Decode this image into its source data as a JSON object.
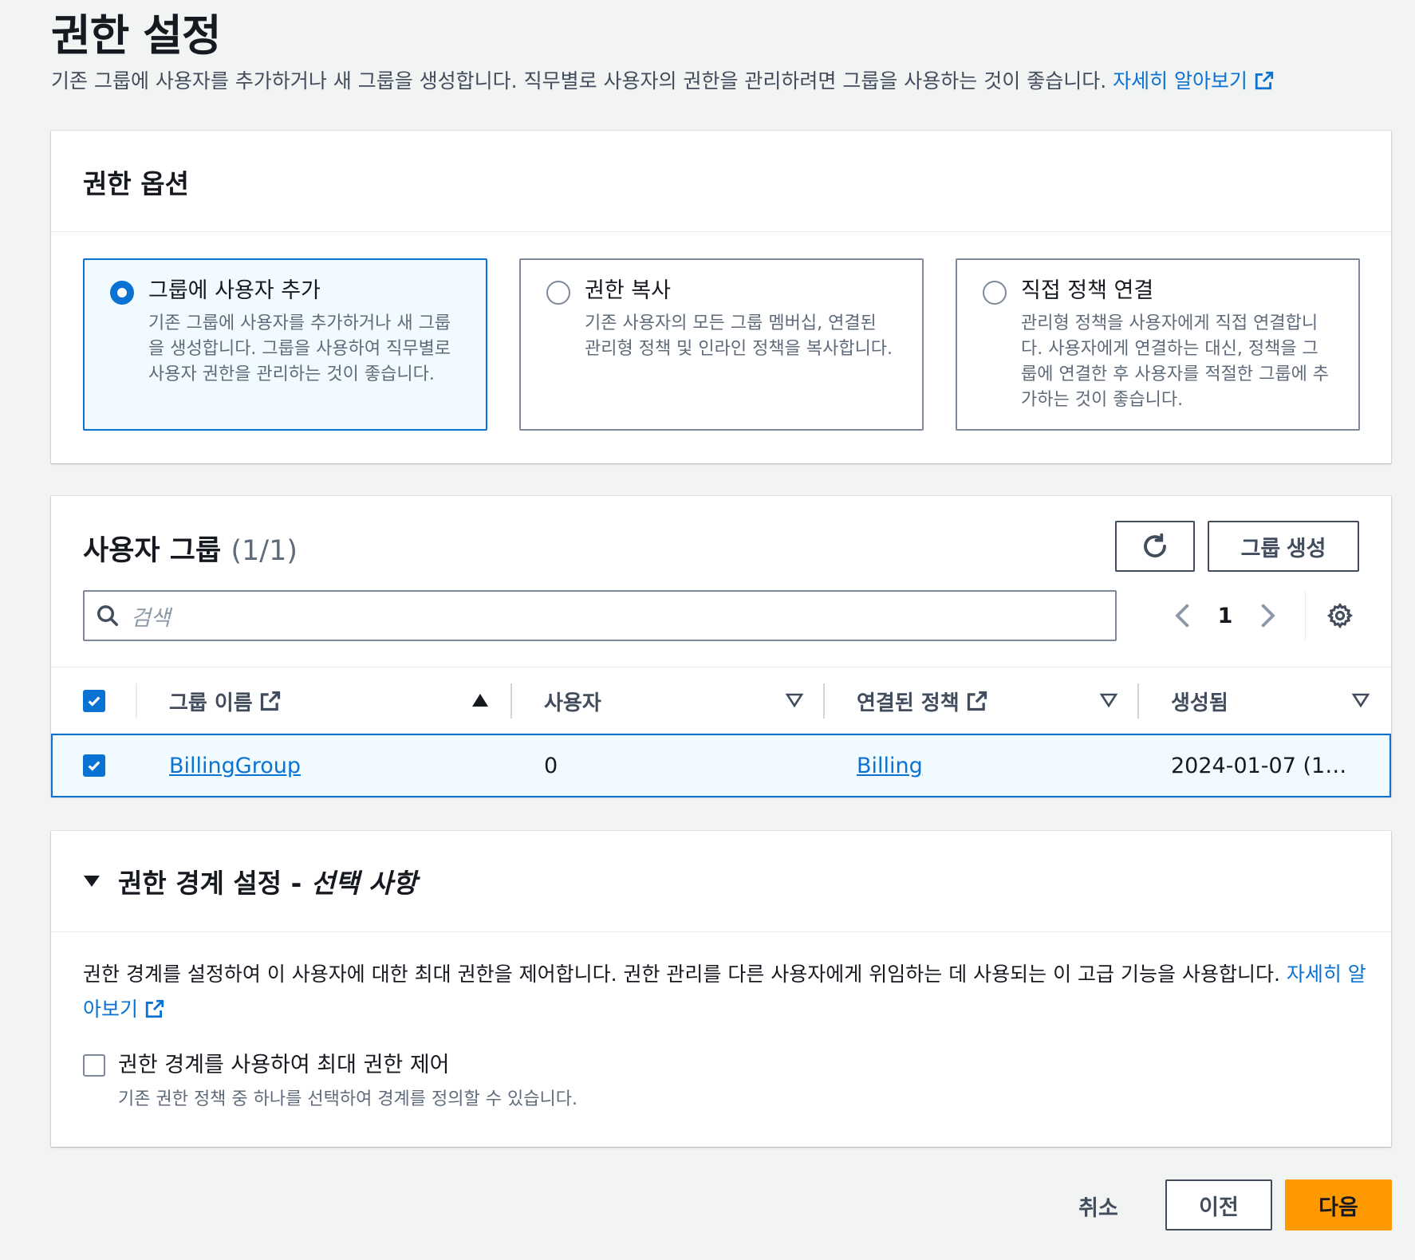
{
  "page": {
    "title": "권한 설정",
    "description": "기존 그룹에 사용자를 추가하거나 새 그룹을 생성합니다. 직무별로 사용자의 권한을 관리하려면 그룹을 사용하는 것이 좋습니다.",
    "learn_more": "자세히 알아보기"
  },
  "options": {
    "title": "권한 옵션",
    "tiles": [
      {
        "title": "그룹에 사용자 추가",
        "desc": "기존 그룹에 사용자를 추가하거나 새 그룹을 생성합니다. 그룹을 사용하여 직무별로 사용자 권한을 관리하는 것이 좋습니다.",
        "selected": true
      },
      {
        "title": "권한 복사",
        "desc": "기존 사용자의 모든 그룹 멤버십, 연결된 관리형 정책 및 인라인 정책을 복사합니다.",
        "selected": false
      },
      {
        "title": "직접 정책 연결",
        "desc": "관리형 정책을 사용자에게 직접 연결합니다. 사용자에게 연결하는 대신, 정책을 그룹에 연결한 후 사용자를 적절한 그룹에 추가하는 것이 좋습니다.",
        "selected": false
      }
    ]
  },
  "groups": {
    "title": "사용자 그룹",
    "count": "(1/1)",
    "create_button": "그룹 생성",
    "search_placeholder": "검색",
    "page_number": "1",
    "columns": {
      "name": "그룹 이름",
      "users": "사용자",
      "policies": "연결된 정책",
      "created": "생성됨"
    },
    "rows": [
      {
        "name": "BillingGroup",
        "users": "0",
        "policies": "Billing",
        "created": "2024-01-07 (1…"
      }
    ]
  },
  "boundary": {
    "title": "권한 경계 설정 - ",
    "title_em": "선택 사항",
    "description": "권한 경계를 설정하여 이 사용자에 대한 최대 권한을 제어합니다. 권한 관리를 다른 사용자에게 위임하는 데 사용되는 이 고급 기능을 사용합니다.",
    "learn_more": "자세히 알아보기",
    "checkbox_label": "권한 경계를 사용하여 최대 권한 제어",
    "checkbox_desc": "기존 권한 정책 중 하나를 선택하여 경계를 정의할 수 있습니다."
  },
  "footer": {
    "cancel": "취소",
    "previous": "이전",
    "next": "다음"
  },
  "colors": {
    "link": "#0972d3",
    "primary_button": "#ff9900",
    "selected_bg": "#f1faff"
  },
  "icons": [
    "external-link-icon",
    "refresh-icon",
    "search-icon",
    "chevron-left-icon",
    "chevron-right-icon",
    "gear-icon",
    "sort-ascending-icon",
    "sort-descending-icon",
    "caret-down-icon",
    "checkmark-icon"
  ]
}
